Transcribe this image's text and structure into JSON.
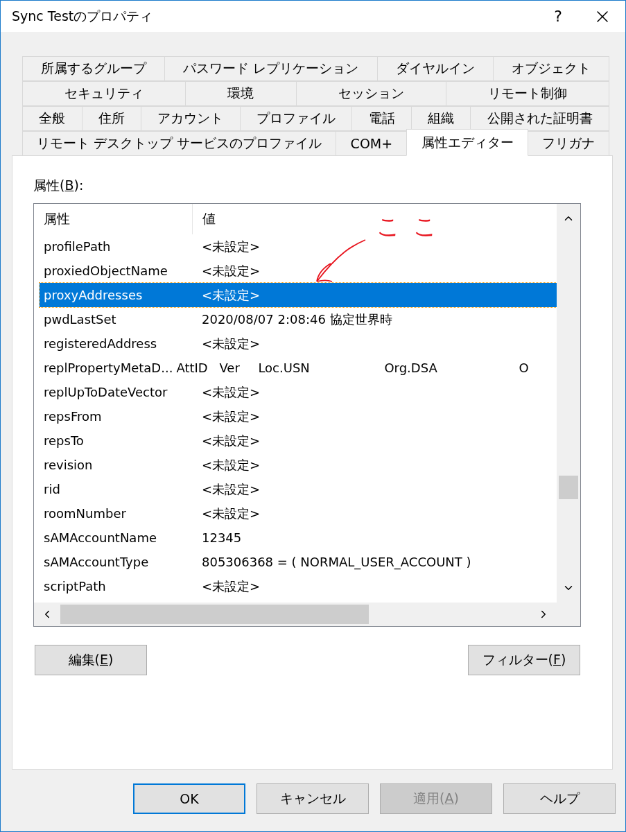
{
  "window": {
    "title": "Sync Testのプロパティ",
    "help_label": "?"
  },
  "tab_rows": [
    [
      {
        "label": "所属するグループ",
        "selected": false
      },
      {
        "label": "パスワード レプリケーション",
        "selected": false
      },
      {
        "label": "ダイヤルイン",
        "selected": false
      },
      {
        "label": "オブジェクト",
        "selected": false
      }
    ],
    [
      {
        "label": "セキュリティ",
        "selected": false
      },
      {
        "label": "環境",
        "selected": false
      },
      {
        "label": "セッション",
        "selected": false
      },
      {
        "label": "リモート制御",
        "selected": false
      }
    ],
    [
      {
        "label": "全般",
        "selected": false
      },
      {
        "label": "住所",
        "selected": false
      },
      {
        "label": "アカウント",
        "selected": false
      },
      {
        "label": "プロファイル",
        "selected": false
      },
      {
        "label": "電話",
        "selected": false
      },
      {
        "label": "組織",
        "selected": false
      },
      {
        "label": "公開された証明書",
        "selected": false
      }
    ],
    [
      {
        "label": "リモート デスクトップ サービスのプロファイル",
        "selected": false
      },
      {
        "label": "COM+",
        "selected": false
      },
      {
        "label": "属性エディター",
        "selected": true
      },
      {
        "label": "フリガナ",
        "selected": false
      }
    ]
  ],
  "attributes_label": {
    "text": "属性(",
    "key": "B",
    "rest": "):"
  },
  "table": {
    "columns": [
      "属性",
      "値"
    ],
    "rows": [
      {
        "name": "profilePath",
        "value": "<未設定>",
        "selected": false
      },
      {
        "name": "proxiedObjectName",
        "value": "<未設定>",
        "selected": false
      },
      {
        "name": "proxyAddresses",
        "value": "<未設定>",
        "selected": true
      },
      {
        "name": "pwdLastSet",
        "value": "2020/08/07 2:08:46 協定世界時",
        "selected": false
      },
      {
        "name": "registeredAddress",
        "value": "<未設定>",
        "selected": false
      },
      {
        "name": "replPropertyMetaD...",
        "value_parts": [
          "AttID",
          "Ver",
          "Loc.USN",
          "Org.DSA",
          "O"
        ],
        "selected": false
      },
      {
        "name": "replUpToDateVector",
        "value": "<未設定>",
        "selected": false
      },
      {
        "name": "repsFrom",
        "value": "<未設定>",
        "selected": false
      },
      {
        "name": "repsTo",
        "value": "<未設定>",
        "selected": false
      },
      {
        "name": "revision",
        "value": "<未設定>",
        "selected": false
      },
      {
        "name": "rid",
        "value": "<未設定>",
        "selected": false
      },
      {
        "name": "roomNumber",
        "value": "<未設定>",
        "selected": false
      },
      {
        "name": "sAMAccountName",
        "value": "12345",
        "selected": false
      },
      {
        "name": "sAMAccountType",
        "value": "805306368 = ( NORMAL_USER_ACCOUNT )",
        "selected": false
      },
      {
        "name": "scriptPath",
        "value": "<未設定>",
        "selected": false
      }
    ]
  },
  "annotation": {
    "text": "ここ"
  },
  "panel_buttons": [
    {
      "text": "編集(",
      "key": "E",
      "rest": ")"
    },
    {
      "text": "フィルター(",
      "key": "F",
      "rest": ")"
    }
  ],
  "dialog_buttons": [
    {
      "label": {
        "text": "OK"
      },
      "default": true,
      "disabled": false
    },
    {
      "label": {
        "text": "キャンセル"
      },
      "default": false,
      "disabled": false
    },
    {
      "label": {
        "text": "適用(",
        "key": "A",
        "rest": ")"
      },
      "default": false,
      "disabled": true
    },
    {
      "label": {
        "text": "ヘルプ"
      },
      "default": false,
      "disabled": false
    }
  ]
}
